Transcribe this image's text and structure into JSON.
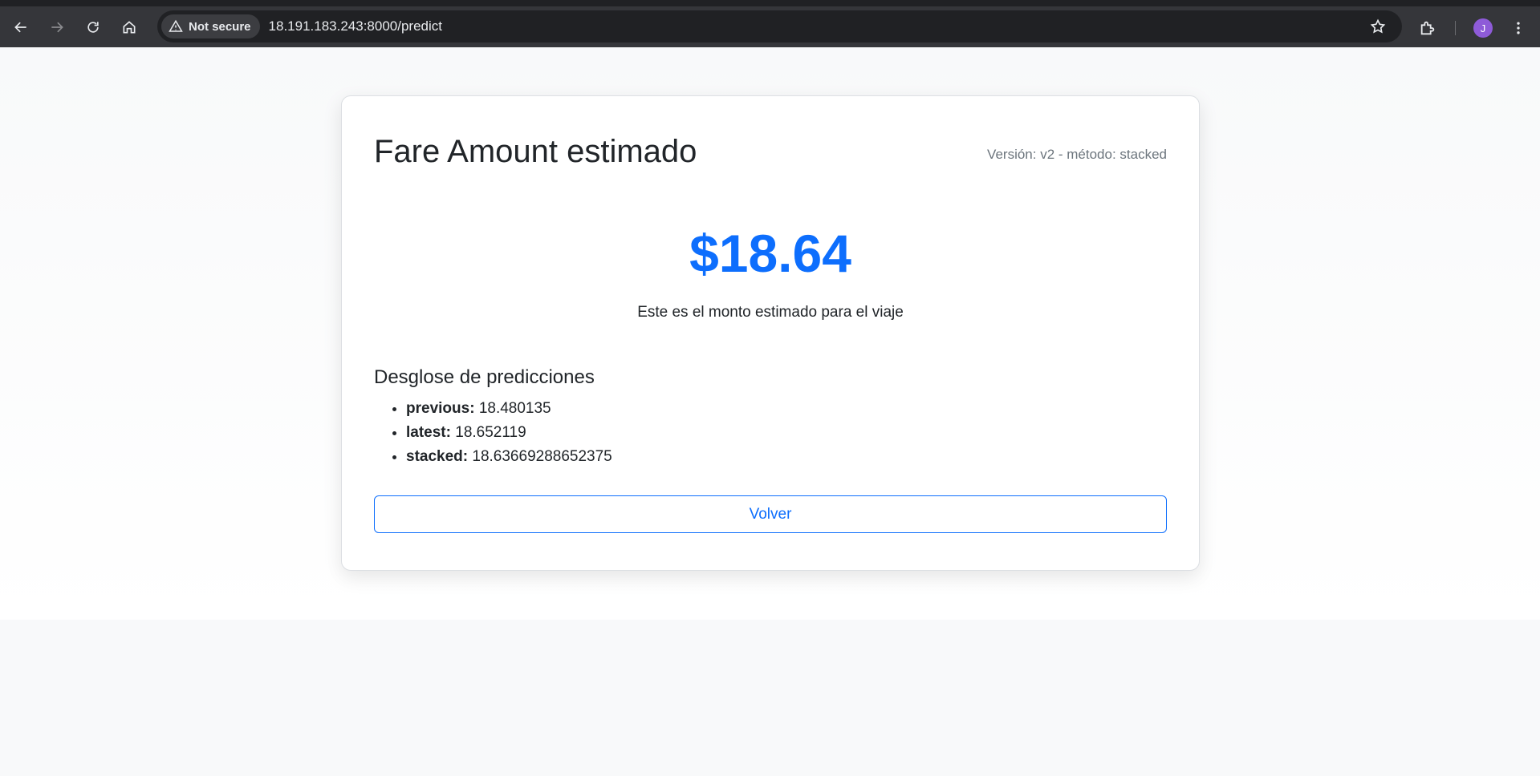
{
  "browser": {
    "security_label": "Not secure",
    "url": "18.191.183.243:8000/predict",
    "profile_initial": "J"
  },
  "card": {
    "title": "Fare Amount estimado",
    "version": "Versión: v2 - método: stacked",
    "amount": "$18.64",
    "subtitle": "Este es el monto estimado para el viaje",
    "breakdown_title": "Desglose de predicciones",
    "breakdown": [
      {
        "label": "previous:",
        "value": "18.480135"
      },
      {
        "label": "latest:",
        "value": "18.652119"
      },
      {
        "label": "stacked:",
        "value": "18.63669288652375"
      }
    ],
    "back_label": "Volver"
  },
  "colors": {
    "accent": "#0d6efd",
    "avatar": "#8e5bd8"
  }
}
